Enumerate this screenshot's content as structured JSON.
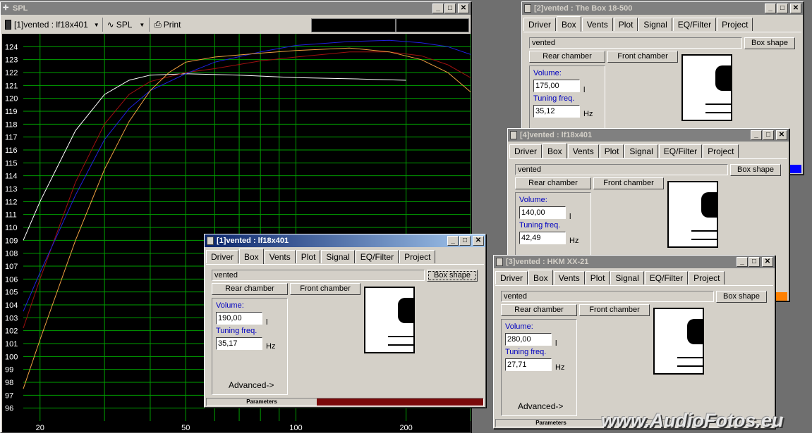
{
  "spl_window": {
    "title": "SPL",
    "driver_select": "[1]vented : lf18x401",
    "mode_select": "SPL",
    "print_label": "Print",
    "y_ticks": [
      "124",
      "123",
      "122",
      "121",
      "120",
      "119",
      "118",
      "117",
      "116",
      "115",
      "114",
      "113",
      "112",
      "111",
      "110",
      "109",
      "108",
      "107",
      "106",
      "105",
      "104",
      "103",
      "102",
      "101",
      "100",
      "99",
      "98",
      "97",
      "96"
    ],
    "x_ticks": [
      "20",
      "50",
      "100",
      "200"
    ]
  },
  "chart_data": {
    "type": "line",
    "x_scale": "log",
    "xlim": [
      18,
      300
    ],
    "ylim": [
      95,
      125
    ],
    "grid": true,
    "series": [
      {
        "color": "#ffffff",
        "x": [
          18,
          20,
          25,
          30,
          35,
          40,
          50,
          70,
          100,
          150,
          200
        ],
        "y": [
          109,
          112,
          117.5,
          120.3,
          121.4,
          121.8,
          121.9,
          121.8,
          121.6,
          121.5,
          121.4
        ]
      },
      {
        "color": "#a01010",
        "x": [
          18,
          20,
          25,
          30,
          35,
          40,
          50,
          60,
          80,
          100,
          140,
          180,
          220,
          260,
          300
        ],
        "y": [
          102.2,
          106,
          113.5,
          118,
          120.3,
          121.3,
          122,
          122.3,
          122.9,
          123.2,
          123.6,
          123.6,
          123.3,
          122.6,
          121.6
        ]
      },
      {
        "color": "#2020e0",
        "x": [
          18,
          20,
          25,
          30,
          35,
          40,
          50,
          60,
          80,
          100,
          140,
          180,
          220,
          260,
          300
        ],
        "y": [
          103.5,
          106.5,
          112.5,
          116.8,
          119.2,
          120.6,
          121.9,
          122.8,
          123.6,
          124.1,
          124.4,
          124.5,
          124.3,
          124,
          123.4
        ]
      },
      {
        "color": "#f0a040",
        "x": [
          18,
          20,
          25,
          30,
          35,
          40,
          45,
          50,
          60,
          80,
          100,
          140,
          180,
          220,
          260,
          300
        ],
        "y": [
          97.5,
          101.3,
          109,
          114.5,
          118.2,
          120.6,
          122,
          122.8,
          123.2,
          123.5,
          123.7,
          123.9,
          123.6,
          123,
          122,
          120.5
        ]
      }
    ]
  },
  "win_box1": {
    "title": "[1]vented :  lf18x401",
    "tabs": [
      "Driver",
      "Box",
      "Vents",
      "Plot",
      "Signal",
      "EQ/Filter",
      "Project"
    ],
    "type_value": "vented",
    "box_shape": "Box shape",
    "rear_chamber": "Rear chamber",
    "front_chamber": "Front chamber",
    "volume_label": "Volume:",
    "volume_value": "190,00",
    "volume_unit": "l",
    "tuning_label": "Tuning freq.",
    "tuning_value": "35,17",
    "tuning_unit": "Hz",
    "advanced": "Advanced->",
    "status": "Parameters"
  },
  "win_box2": {
    "title": "[2]vented : The Box 18-500",
    "tabs": [
      "Driver",
      "Box",
      "Vents",
      "Plot",
      "Signal",
      "EQ/Filter",
      "Project"
    ],
    "type_value": "vented",
    "box_shape": "Box shape",
    "rear_chamber": "Rear chamber",
    "front_chamber": "Front chamber",
    "volume_label": "Volume:",
    "volume_value": "175,00",
    "volume_unit": "l",
    "tuning_label": "Tuning freq.",
    "tuning_value": "35,12",
    "tuning_unit": "Hz"
  },
  "win_box4": {
    "title": "[4]vented :  lf18x401",
    "tabs": [
      "Driver",
      "Box",
      "Vents",
      "Plot",
      "Signal",
      "EQ/Filter",
      "Project"
    ],
    "type_value": "vented",
    "box_shape": "Box shape",
    "rear_chamber": "Rear chamber",
    "front_chamber": "Front chamber",
    "volume_label": "Volume:",
    "volume_value": "140,00",
    "volume_unit": "l",
    "tuning_label": "Tuning freq.",
    "tuning_value": "42,49",
    "tuning_unit": "Hz"
  },
  "win_box3": {
    "title": "[3]vented : HKM XX-21",
    "tabs": [
      "Driver",
      "Box",
      "Vents",
      "Plot",
      "Signal",
      "EQ/Filter",
      "Project"
    ],
    "type_value": "vented",
    "box_shape": "Box shape",
    "rear_chamber": "Rear chamber",
    "front_chamber": "Front chamber",
    "volume_label": "Volume:",
    "volume_value": "280,00",
    "volume_unit": "l",
    "tuning_label": "Tuning freq.",
    "tuning_value": "27,71",
    "tuning_unit": "Hz",
    "advanced": "Advanced->",
    "status": "Parameters"
  },
  "watermark": "www.AudioFotos.eu",
  "colors": {
    "blue_strip": "#0000ff",
    "orange_strip": "#ff8000",
    "plot_bg": "#000000",
    "grid": "#00a000"
  }
}
